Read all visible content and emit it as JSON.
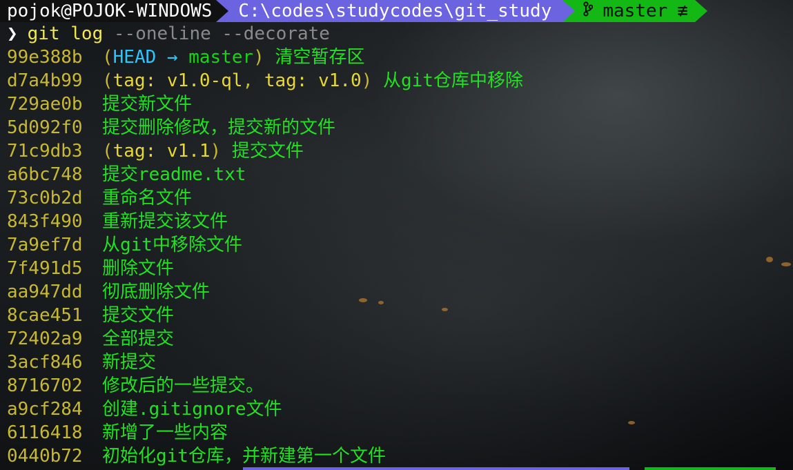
{
  "prompt": {
    "user_host": "pojok@POJOK-WINDOWS",
    "path": "C:\\codes\\studycodes\\git_study",
    "git_icon": "git-branch-icon",
    "branch": "master",
    "status_symbol": "≢",
    "colors": {
      "user_bg": "#111111",
      "path_bg": "#6c63e0",
      "git_bg": "#14b814"
    }
  },
  "command": {
    "chevron": "❯",
    "program": "git log",
    "args": "--oneline --decorate"
  },
  "log": [
    {
      "hash": "99e388b",
      "refs": [
        {
          "type": "head",
          "text": "HEAD"
        },
        {
          "type": "arrow",
          "text": " → "
        },
        {
          "type": "branch",
          "text": "master"
        }
      ],
      "message": "清空暂存区"
    },
    {
      "hash": "d7a4b99",
      "refs": [
        {
          "type": "tag",
          "text": "tag: v1.0-ql"
        },
        {
          "type": "comma",
          "text": ", "
        },
        {
          "type": "tag",
          "text": "tag: v1.0"
        }
      ],
      "message": "从git仓库中移除"
    },
    {
      "hash": "729ae0b",
      "refs": [],
      "message": "提交新文件"
    },
    {
      "hash": "5d092f0",
      "refs": [],
      "message": "提交删除修改，提交新的文件"
    },
    {
      "hash": "71c9db3",
      "refs": [
        {
          "type": "tag",
          "text": "tag: v1.1"
        }
      ],
      "message": "提交文件"
    },
    {
      "hash": "a6bc748",
      "refs": [],
      "message": "提交readme.txt"
    },
    {
      "hash": "73c0b2d",
      "refs": [],
      "message": "重命名文件"
    },
    {
      "hash": "843f490",
      "refs": [],
      "message": "重新提交该文件"
    },
    {
      "hash": "7a9ef7d",
      "refs": [],
      "message": "从git中移除文件"
    },
    {
      "hash": "7f491d5",
      "refs": [],
      "message": "删除文件"
    },
    {
      "hash": "aa947dd",
      "refs": [],
      "message": "彻底删除文件"
    },
    {
      "hash": "8cae451",
      "refs": [],
      "message": "提交文件"
    },
    {
      "hash": "72402a9",
      "refs": [],
      "message": "全部提交"
    },
    {
      "hash": "3acf846",
      "refs": [],
      "message": "新提交"
    },
    {
      "hash": "8716702",
      "refs": [],
      "message": "修改后的一些提交。"
    },
    {
      "hash": "a9cf284",
      "refs": [],
      "message": "创建.gitignore文件"
    },
    {
      "hash": "6116418",
      "refs": [],
      "message": "新增了一些内容"
    },
    {
      "hash": "0440b72",
      "refs": [],
      "message": "初始化git仓库，并新建第一个文件"
    }
  ]
}
